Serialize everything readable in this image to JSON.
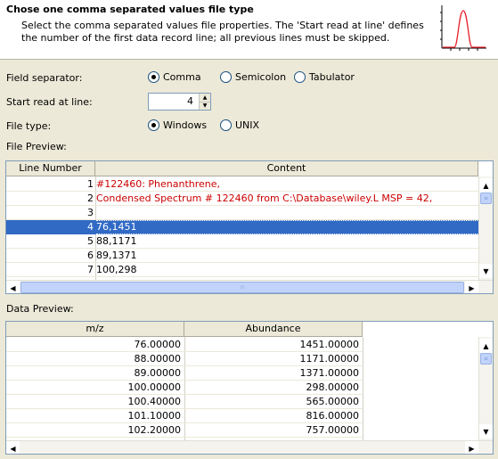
{
  "header": {
    "title": "Chose one comma separated values file type",
    "description": "Select the comma separated values file properties. The 'Start read at line' defines the number of the first data record line; all previous lines must be skipped."
  },
  "field_separator": {
    "label": "Field separator:",
    "options": [
      "Comma",
      "Semicolon",
      "Tabulator"
    ],
    "selected": "Comma"
  },
  "start_line": {
    "label": "Start read at line:",
    "value": "4"
  },
  "file_type": {
    "label": "File type:",
    "options": [
      "Windows",
      "UNIX"
    ],
    "selected": "Windows"
  },
  "file_preview": {
    "label": "File Preview:",
    "columns": [
      "Line Number",
      "Content"
    ],
    "rows": [
      {
        "line": "1",
        "content": "#122460: Phenanthrene,",
        "red": true
      },
      {
        "line": "2",
        "content": "Condensed Spectrum # 122460 from C:\\Database\\wiley.L MSP = 42,",
        "red": true
      },
      {
        "line": "3",
        "content": "",
        "red": false
      },
      {
        "line": "4",
        "content": "76,1451",
        "selected": true
      },
      {
        "line": "5",
        "content": "88,1171"
      },
      {
        "line": "6",
        "content": "89,1371"
      },
      {
        "line": "7",
        "content": "100,298"
      }
    ]
  },
  "data_preview": {
    "label": "Data Preview:",
    "columns": [
      "m/z",
      "Abundance"
    ],
    "rows": [
      {
        "mz": "76.00000",
        "ab": "1451.00000"
      },
      {
        "mz": "88.00000",
        "ab": "1171.00000"
      },
      {
        "mz": "89.00000",
        "ab": "1371.00000"
      },
      {
        "mz": "100.00000",
        "ab": "298.00000"
      },
      {
        "mz": "100.40000",
        "ab": "565.00000"
      },
      {
        "mz": "101.10000",
        "ab": "816.00000"
      },
      {
        "mz": "102.20000",
        "ab": "757.00000"
      }
    ]
  },
  "colors": {
    "selection": "#316ac5",
    "red_text": "#cc0000",
    "graph": "#e8202a"
  }
}
